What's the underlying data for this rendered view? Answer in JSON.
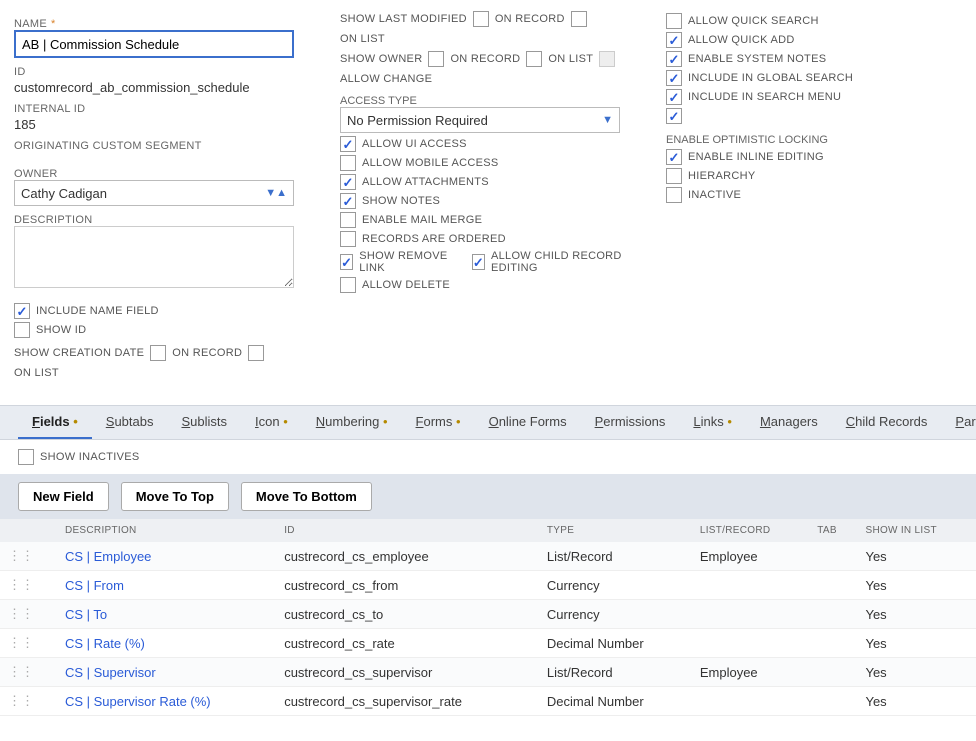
{
  "labels": {
    "name": "NAME",
    "id": "ID",
    "internal_id": "INTERNAL ID",
    "orig_segment": "ORIGINATING CUSTOM SEGMENT",
    "owner": "OWNER",
    "description": "DESCRIPTION",
    "include_name_field": "INCLUDE NAME FIELD",
    "show_id": "SHOW ID",
    "show_creation_date": "SHOW CREATION DATE",
    "on_record": "ON RECORD",
    "on_list": "ON LIST",
    "show_last_modified": "SHOW LAST MODIFIED",
    "show_owner": "SHOW OWNER",
    "allow_change": "ALLOW CHANGE",
    "access_type": "ACCESS TYPE",
    "allow_ui_access": "ALLOW UI ACCESS",
    "allow_mobile_access": "ALLOW MOBILE ACCESS",
    "allow_attachments": "ALLOW ATTACHMENTS",
    "show_notes": "SHOW NOTES",
    "enable_mail_merge": "ENABLE MAIL MERGE",
    "records_are_ordered": "RECORDS ARE ORDERED",
    "show_remove_link": "SHOW REMOVE LINK",
    "allow_child_record_editing": "ALLOW CHILD RECORD EDITING",
    "allow_delete": "ALLOW DELETE",
    "allow_quick_search": "ALLOW QUICK SEARCH",
    "allow_quick_add": "ALLOW QUICK ADD",
    "enable_system_notes": "ENABLE SYSTEM NOTES",
    "include_global_search": "INCLUDE IN GLOBAL SEARCH",
    "include_search_menu": "INCLUDE IN SEARCH MENU",
    "enable_optimistic_locking": "ENABLE OPTIMISTIC LOCKING",
    "enable_inline_editing": "ENABLE INLINE EDITING",
    "hierarchy": "HIERARCHY",
    "inactive": "INACTIVE",
    "show_inactives": "SHOW INACTIVES"
  },
  "values": {
    "name": "AB | Commission Schedule",
    "id": "customrecord_ab_commission_schedule",
    "internal_id": "185",
    "owner": "Cathy Cadigan",
    "access_type": "No Permission Required",
    "orig_segment": ""
  },
  "tabs": [
    {
      "label": "Fields",
      "mnemonic": "F",
      "dot": true,
      "active": true
    },
    {
      "label": "Subtabs",
      "mnemonic": "S",
      "dot": false,
      "active": false
    },
    {
      "label": "Sublists",
      "mnemonic": "S",
      "dot": false,
      "active": false
    },
    {
      "label": "Icon",
      "mnemonic": "I",
      "dot": true,
      "active": false
    },
    {
      "label": "Numbering",
      "mnemonic": "N",
      "dot": true,
      "active": false
    },
    {
      "label": "Forms",
      "mnemonic": "F",
      "dot": true,
      "active": false
    },
    {
      "label": "Online Forms",
      "mnemonic": "O",
      "dot": false,
      "active": false
    },
    {
      "label": "Permissions",
      "mnemonic": "P",
      "dot": false,
      "active": false
    },
    {
      "label": "Links",
      "mnemonic": "L",
      "dot": true,
      "active": false
    },
    {
      "label": "Managers",
      "mnemonic": "M",
      "dot": false,
      "active": false
    },
    {
      "label": "Child Records",
      "mnemonic": "C",
      "dot": false,
      "active": false
    },
    {
      "label": "Parent Records",
      "mnemonic": "P",
      "dot": false,
      "active": false
    }
  ],
  "buttons": {
    "new_field": "New Field",
    "move_top": "Move To Top",
    "move_bottom": "Move To Bottom"
  },
  "table": {
    "headers": [
      "",
      "DESCRIPTION",
      "ID",
      "TYPE",
      "LIST/RECORD",
      "TAB",
      "SHOW IN LIST"
    ],
    "rows": [
      {
        "desc": "CS | Employee",
        "id": "custrecord_cs_employee",
        "type": "List/Record",
        "list_record": "Employee",
        "tab": "",
        "show": "Yes"
      },
      {
        "desc": "CS | From",
        "id": "custrecord_cs_from",
        "type": "Currency",
        "list_record": "",
        "tab": "",
        "show": "Yes"
      },
      {
        "desc": "CS | To",
        "id": "custrecord_cs_to",
        "type": "Currency",
        "list_record": "",
        "tab": "",
        "show": "Yes"
      },
      {
        "desc": "CS | Rate (%)",
        "id": "custrecord_cs_rate",
        "type": "Decimal Number",
        "list_record": "",
        "tab": "",
        "show": "Yes"
      },
      {
        "desc": "CS | Supervisor",
        "id": "custrecord_cs_supervisor",
        "type": "List/Record",
        "list_record": "Employee",
        "tab": "",
        "show": "Yes"
      },
      {
        "desc": "CS | Supervisor Rate (%)",
        "id": "custrecord_cs_supervisor_rate",
        "type": "Decimal Number",
        "list_record": "",
        "tab": "",
        "show": "Yes"
      }
    ]
  }
}
